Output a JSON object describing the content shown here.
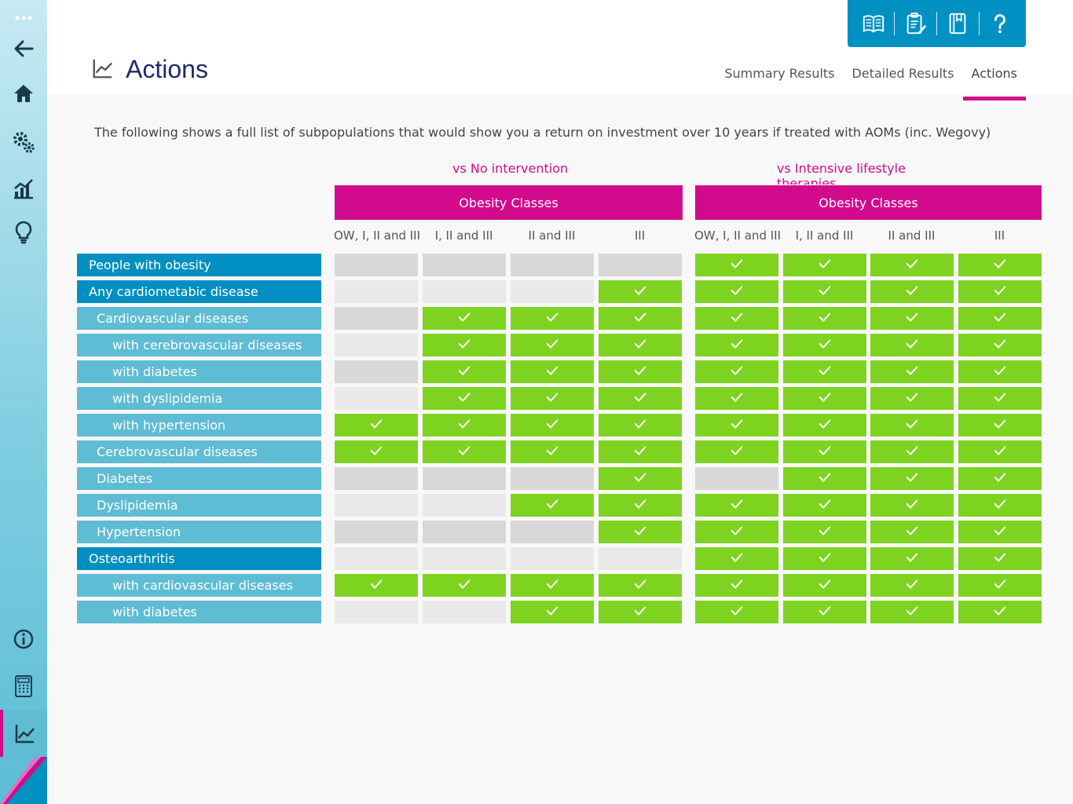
{
  "page": {
    "title": "Actions"
  },
  "tabs": [
    {
      "label": "Summary Results",
      "active": false
    },
    {
      "label": "Detailed Results",
      "active": false
    },
    {
      "label": "Actions",
      "active": true
    }
  ],
  "toolbar": {
    "icons": [
      "book-icon",
      "clipboard-edit-icon",
      "notebook-icon",
      "help-icon"
    ]
  },
  "sidebar": {
    "icons": [
      "more-icon",
      "back-arrow-icon",
      "home-icon",
      "settings-gears-icon",
      "bar-chart-icon",
      "lightbulb-icon",
      "info-icon",
      "calculator-icon",
      "line-chart-icon"
    ],
    "active": "line-chart-icon"
  },
  "intro": "The following shows a full list of subpopulations that would show you a return on investment over 10 years if treated with AOMs (inc. Wegovy)",
  "groups": [
    {
      "label": "vs No intervention",
      "header": "Obesity Classes"
    },
    {
      "label": "vs Intensive lifestyle therapies",
      "header": "Obesity Classes"
    }
  ],
  "columns": [
    "OW, I, II and III",
    "I, II and III",
    "II and III",
    "III",
    "OW, I, II and III",
    "I, II and III",
    "II and III",
    "III"
  ],
  "legend_colors": {
    "yes": "#7ed321",
    "no_dark": "#d8d8d8",
    "no_light": "#e9e9e9",
    "accent": "#d20a8c",
    "primary": "#008fc0"
  },
  "rows": [
    {
      "label": "People with obesity",
      "level": 0,
      "cells": [
        "d",
        "d",
        "d",
        "d",
        "y",
        "y",
        "y",
        "y"
      ]
    },
    {
      "label": "Any cardiometabic disease",
      "level": 0,
      "cells": [
        "l",
        "l",
        "l",
        "y",
        "y",
        "y",
        "y",
        "y"
      ]
    },
    {
      "label": "Cardiovascular diseases",
      "level": 1,
      "cells": [
        "d",
        "y",
        "y",
        "y",
        "y",
        "y",
        "y",
        "y"
      ]
    },
    {
      "label": "with cerebrovascular diseases",
      "level": 2,
      "cells": [
        "l",
        "y",
        "y",
        "y",
        "y",
        "y",
        "y",
        "y"
      ]
    },
    {
      "label": "with diabetes",
      "level": 2,
      "cells": [
        "d",
        "y",
        "y",
        "y",
        "y",
        "y",
        "y",
        "y"
      ]
    },
    {
      "label": "with dyslipidemia",
      "level": 2,
      "cells": [
        "l",
        "y",
        "y",
        "y",
        "y",
        "y",
        "y",
        "y"
      ]
    },
    {
      "label": "with hypertension",
      "level": 2,
      "cells": [
        "y",
        "y",
        "y",
        "y",
        "y",
        "y",
        "y",
        "y"
      ]
    },
    {
      "label": "Cerebrovascular diseases",
      "level": 1,
      "cells": [
        "y",
        "y",
        "y",
        "y",
        "y",
        "y",
        "y",
        "y"
      ]
    },
    {
      "label": "Diabetes",
      "level": 1,
      "cells": [
        "d",
        "d",
        "d",
        "y",
        "d",
        "y",
        "y",
        "y"
      ]
    },
    {
      "label": "Dyslipidemia",
      "level": 1,
      "cells": [
        "l",
        "l",
        "y",
        "y",
        "y",
        "y",
        "y",
        "y"
      ]
    },
    {
      "label": "Hypertension",
      "level": 1,
      "cells": [
        "d",
        "d",
        "d",
        "y",
        "y",
        "y",
        "y",
        "y"
      ]
    },
    {
      "label": "Osteoarthritis",
      "level": 0,
      "cells": [
        "l",
        "l",
        "l",
        "l",
        "y",
        "y",
        "y",
        "y"
      ]
    },
    {
      "label": "with cardiovascular diseases",
      "level": 2,
      "cells": [
        "y",
        "y",
        "y",
        "y",
        "y",
        "y",
        "y",
        "y"
      ]
    },
    {
      "label": "with diabetes",
      "level": 2,
      "cells": [
        "l",
        "l",
        "y",
        "y",
        "y",
        "y",
        "y",
        "y"
      ]
    }
  ]
}
